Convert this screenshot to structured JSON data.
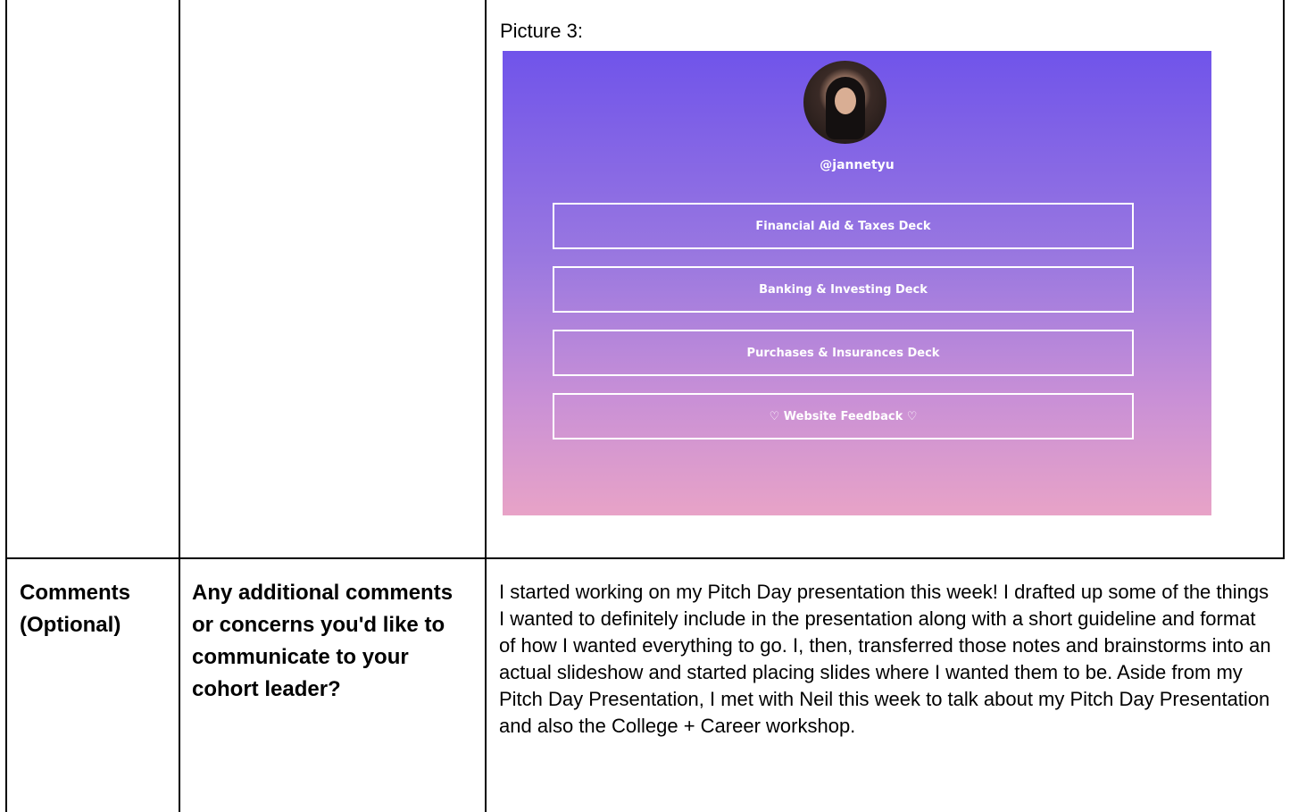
{
  "row1": {
    "picture_label": "Picture 3:",
    "profile": {
      "handle": "@jannetyu",
      "links": [
        "Financial Aid & Taxes Deck",
        "Banking & Investing Deck",
        "Purchases & Insurances Deck",
        "♡ Website Feedback ♡"
      ]
    }
  },
  "row2": {
    "col1": "Comments (Optional)",
    "col2": "Any additional comments or concerns you'd like to communicate to your cohort leader?",
    "col3": "I started working on my Pitch Day presentation this week! I drafted up some of the things I wanted to definitely include in the presentation along with a short guideline and format of how I wanted everything to go. I, then, transferred those notes and brainstorms into an actual slideshow and started placing slides where I wanted them to be. Aside from my Pitch Day Presentation, I met with Neil this week to talk about my Pitch Day Presentation and also the College + Career workshop."
  }
}
